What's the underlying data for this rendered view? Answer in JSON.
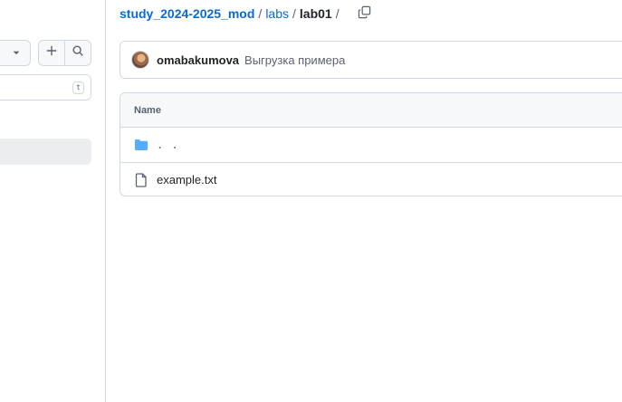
{
  "breadcrumb": {
    "repo": "study_2024-2025_mod",
    "separator": "/",
    "folder": "labs",
    "current": "lab01"
  },
  "sidebar": {
    "filter_shortcut": "t"
  },
  "commit": {
    "author": "omabakumova",
    "message": "Выгрузка примера"
  },
  "table": {
    "header_name": "Name",
    "rows": [
      {
        "type": "folder",
        "label": ". ."
      },
      {
        "type": "file",
        "label": "example.txt"
      }
    ]
  },
  "icons": {
    "chevron": "chevron-down-icon",
    "plus": "plus-icon",
    "search": "search-icon",
    "copy": "copy-icon",
    "folder": "folder-icon",
    "file": "file-icon"
  },
  "colors": {
    "link": "#0969da",
    "folder": "#54aeff",
    "border": "#d1d9e0",
    "muted": "#59636e",
    "selected_bg": "#ebedf0"
  }
}
